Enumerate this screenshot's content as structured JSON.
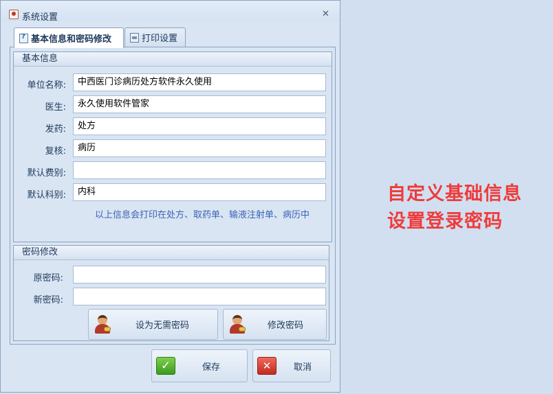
{
  "window": {
    "title": "系统设置",
    "close_symbol": "✕",
    "app_icon": "settings-app-icon"
  },
  "tabs": [
    {
      "label": "基本信息和密码修改",
      "active": true,
      "icon": "help-icon"
    },
    {
      "label": "打印设置",
      "active": false,
      "icon": "printer-icon"
    }
  ],
  "basic_info": {
    "header": "基本信息",
    "fields": [
      {
        "label": "单位名称:",
        "value": "中西医门诊病历处方软件永久使用"
      },
      {
        "label": "医生:",
        "value": "永久使用软件管家"
      },
      {
        "label": "发药:",
        "value": "处方"
      },
      {
        "label": "复核:",
        "value": "病历"
      },
      {
        "label": "默认费别:",
        "value": ""
      },
      {
        "label": "默认科别:",
        "value": "内科"
      }
    ],
    "note": "以上信息会打印在处方、取药单、输液注射单、病历中"
  },
  "password": {
    "header": "密码修改",
    "old_label": "原密码:",
    "old_value": "",
    "new_label": "新密码:",
    "new_value": "",
    "no_password_button": "设为无需密码",
    "change_password_button": "修改密码"
  },
  "footer": {
    "save": "保存",
    "cancel": "取消",
    "save_icon_glyph": "✓",
    "cancel_icon_glyph": "✕"
  },
  "promo": {
    "line1": "自定义基础信息",
    "line2": "设置登录密码"
  },
  "colors": {
    "promo_text": "#ef3b3b",
    "note_text": "#3b63b5",
    "window_bg": "#d9e5f3",
    "page_bg": "#d1dff0"
  }
}
